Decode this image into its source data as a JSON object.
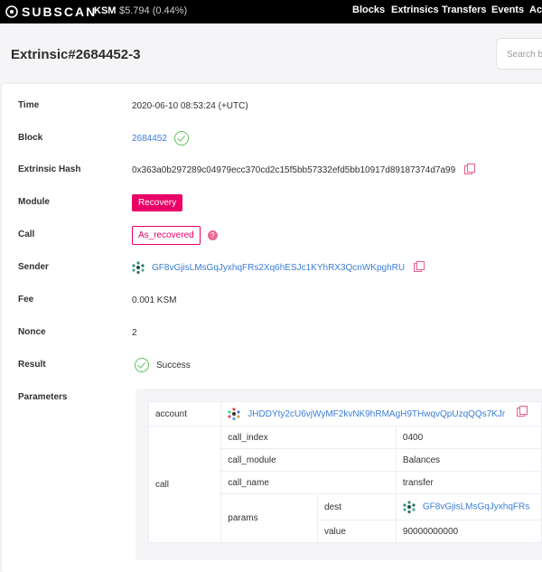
{
  "header": {
    "logo_text": "SUBSCAN",
    "token": "KSM",
    "price": "$5.794 (0.44%)",
    "nav": [
      "Blocks",
      "Extrinsics",
      "Transfers",
      "Events",
      "Acc"
    ]
  },
  "page": {
    "title": "Extrinsic#2684452-3",
    "search_placeholder": "Search b"
  },
  "details": {
    "time_label": "Time",
    "time": "2020-06-10 08:53:24 (+UTC)",
    "block_label": "Block",
    "block": "2684452",
    "hash_label": "Extrinsic Hash",
    "hash": "0x363a0b297289c04979ecc370cd2c15f5bb57332efd5bb10917d89187374d7a99",
    "module_label": "Module",
    "module": "Recovery",
    "call_label": "Call",
    "call": "As_recovered",
    "sender_label": "Sender",
    "sender": "GF8vGjisLMsGqJyxhqFRs2Xq6hESJc1KYhRX3QcnWKpghRU",
    "fee_label": "Fee",
    "fee": "0.001 KSM",
    "nonce_label": "Nonce",
    "nonce": "2",
    "result_label": "Result",
    "result": "Success",
    "parameters_label": "Parameters"
  },
  "params": {
    "account_key": "account",
    "account_value": "JHDDYty2cU6vjWyMF2kvNK9hRMAgH9THwqvQpUzqQQs7KJr",
    "call_key": "call",
    "call_index_key": "call_index",
    "call_index": "0400",
    "call_module_key": "call_module",
    "call_module": "Balances",
    "call_name_key": "call_name",
    "call_name": "transfer",
    "params_key": "params",
    "dest_key": "dest",
    "dest_value": "GF8vGjisLMsGqJyxhqFRs",
    "value_key": "value",
    "value": "90000000000"
  },
  "colors": {
    "accent": "#e90066",
    "link": "#3b7dd8",
    "success": "#5dc35d"
  }
}
